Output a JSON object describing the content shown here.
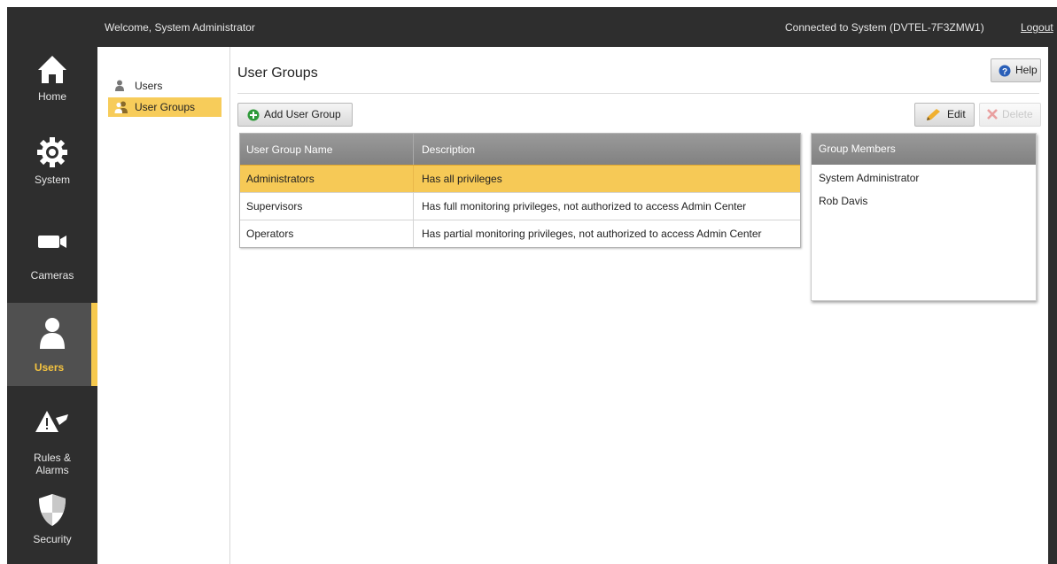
{
  "header": {
    "welcome": "Welcome, System Administrator",
    "connection": "Connected to System (DVTEL-7F3ZMW1)",
    "logout": "Logout"
  },
  "nav": [
    {
      "label": "Home",
      "icon": "home-icon"
    },
    {
      "label": "System",
      "icon": "gear-icon"
    },
    {
      "label": "Cameras",
      "icon": "camera-icon"
    },
    {
      "label": "Users",
      "icon": "user-icon",
      "active": true
    },
    {
      "label": "Rules &",
      "label2": "Alarms",
      "icon": "rules-icon"
    },
    {
      "label": "Security",
      "icon": "shield-icon"
    }
  ],
  "subnav": [
    {
      "label": "Users",
      "icon": "user-icon"
    },
    {
      "label": "User Groups",
      "icon": "user-group-icon",
      "active": true
    }
  ],
  "page": {
    "title": "User Groups",
    "help": "Help",
    "add": "Add User Group",
    "edit": "Edit",
    "delete": "Delete"
  },
  "table": {
    "columns": [
      "User Group Name",
      "Description"
    ],
    "rows": [
      {
        "name": "Administrators",
        "description": "Has all privileges"
      },
      {
        "name": "Supervisors",
        "description": "Has full monitoring privileges, not authorized to access Admin Center"
      },
      {
        "name": "Operators",
        "description": "Has partial monitoring privileges,  not authorized to access Admin Center"
      }
    ],
    "selected_row": 0
  },
  "members": {
    "title": "Group Members",
    "items": [
      "System Administrator",
      "Rob Davis"
    ]
  },
  "colors": {
    "accent": "#f6c94e",
    "frame": "#2e2e2e",
    "header_gradient": "#8c8c8c"
  }
}
